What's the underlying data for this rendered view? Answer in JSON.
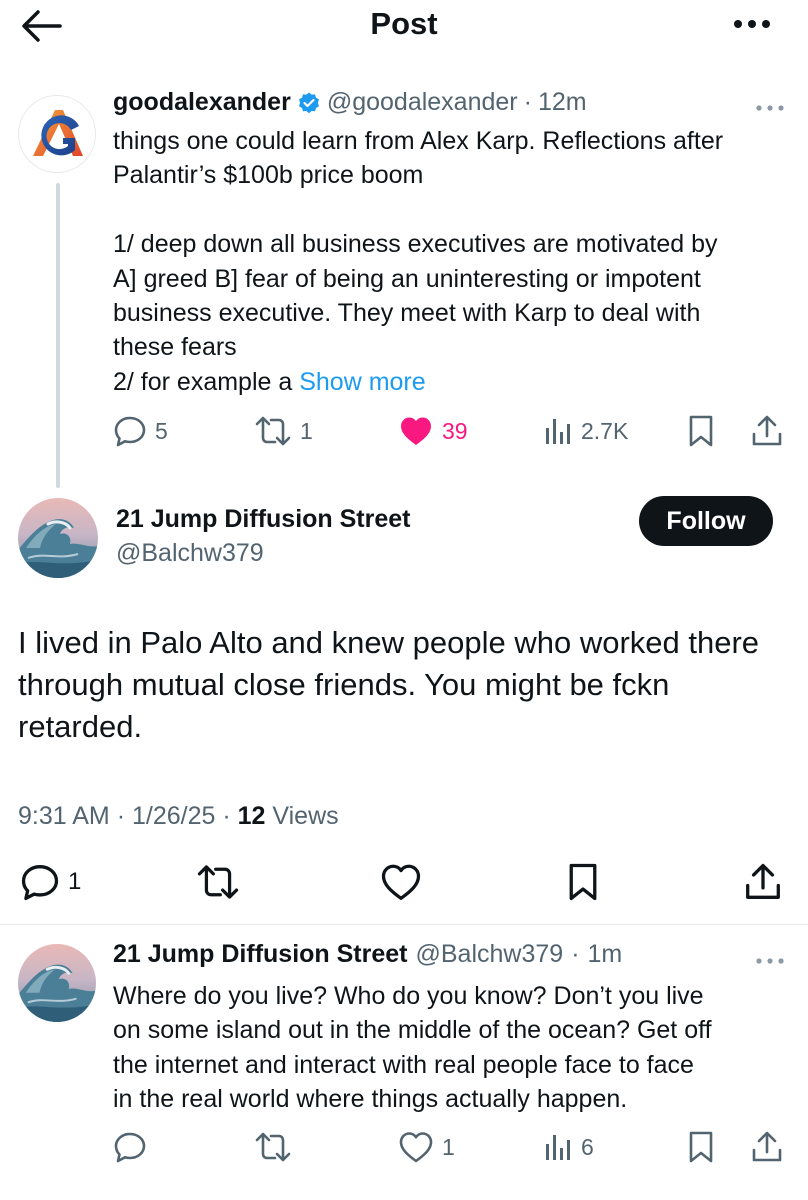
{
  "header": {
    "title": "Post",
    "back_icon": "arrow-left-icon",
    "more_icon": "more-horizontal-icon"
  },
  "colors": {
    "text": "#0f1419",
    "muted": "#536471",
    "link": "#1d9bf0",
    "like": "#f91880",
    "verified": "#1d9bf0",
    "follow_bg": "#0f1419"
  },
  "parent_post": {
    "display_name": "goodalexander",
    "verified": true,
    "handle": "@goodalexander",
    "separator": "·",
    "time": "12m",
    "lines": [
      "things one could learn from Alex Karp. Reflections after",
      "Palantir’s $100b price boom",
      "",
      "1/ deep down all business executives are motivated by",
      "A] greed B] fear of being an uninteresting or impotent",
      "business executive. They meet with Karp to deal with",
      "these fears"
    ],
    "last_line_text": "2/ for example a ",
    "show_more": "Show more",
    "stats": {
      "replies": "5",
      "reposts": "1",
      "likes": "39",
      "views": "2.7K"
    }
  },
  "main_post": {
    "display_name": "21 Jump Diffusion Street",
    "handle": "@Balchw379",
    "follow_label": "Follow",
    "lines": [
      "I lived in Palo Alto and knew people who worked there",
      "through mutual close friends. You might be fckn",
      "retarded."
    ],
    "time": "9:31 AM",
    "date": "1/26/25",
    "separator": "·",
    "views_count": "12",
    "views_label": "Views",
    "stats": {
      "replies": "1"
    }
  },
  "reply_post": {
    "display_name": "21 Jump Diffusion Street",
    "handle": "@Balchw379",
    "separator": "·",
    "time": "1m",
    "lines": [
      "Where do you live? Who do you know? Don’t you live",
      "on some island out in the middle of the ocean? Get off",
      "the internet and interact with real people face to face",
      "in the real world where things actually happen."
    ],
    "stats": {
      "likes": "1",
      "views": "6"
    }
  }
}
